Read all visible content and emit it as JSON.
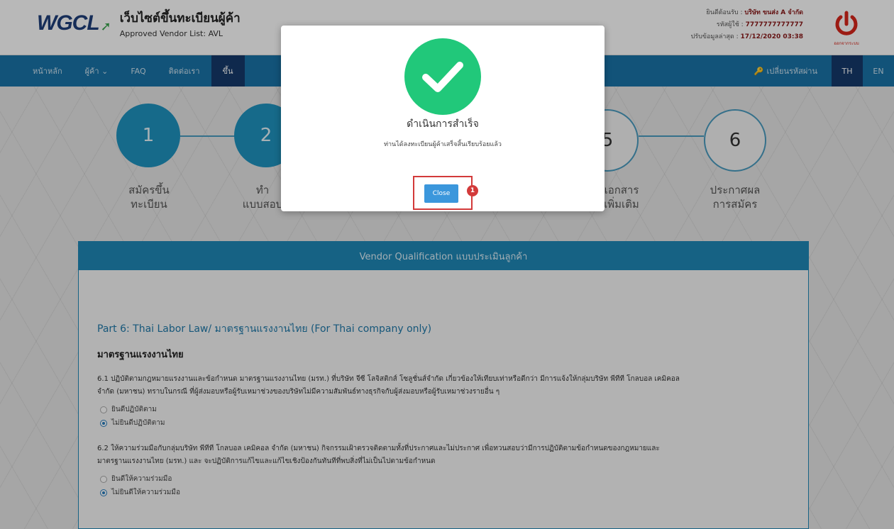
{
  "header": {
    "logo": "WGCL",
    "site_title": "เว็บไซต์ขึ้นทะเบียนผู้ค้า",
    "site_subtitle": "Approved Vendor List: AVL",
    "welcome_label": "ยินดีต้อนรับ :",
    "welcome_name": "บริษัท ขนส่ง A จำกัด",
    "code_label": "รหัสผู้ใช้ :",
    "code_value": "7777777777777",
    "updated_label": "ปรับข้อมูลล่าสุด :",
    "updated_value": "17/12/2020 03:38",
    "logout_label": "ออกจากระบบ"
  },
  "nav": {
    "items": [
      "หน้าหลัก",
      "ผู้ค้า ⌄",
      "FAQ",
      "ติดต่อเรา",
      "ขึ้น"
    ],
    "change_password": "เปลี่ยนรหัสผ่าน",
    "lang_th": "TH",
    "lang_en": "EN"
  },
  "steps": [
    {
      "number": "1",
      "label_line1": "สมัครขึ้น",
      "label_line2": "ทะเบียน"
    },
    {
      "number": "2",
      "label_line1": "ทำ",
      "label_line2": "แบบสอบ"
    },
    {
      "number": "5",
      "label_line1": "เอกสาร",
      "label_line2": "เพิ่มเติม"
    },
    {
      "number": "6",
      "label_line1": "ประกาศผล",
      "label_line2": "การสมัคร"
    }
  ],
  "card": {
    "header": "Vendor Qualification แบบประเมินลูกค้า",
    "part_title": "Part 6: Thai Labor Law/ มาตรฐานแรงงานไทย (For Thai company only)",
    "section_title": "มาตรฐานแรงงานไทย",
    "q1_line1": "6.1 ปฏิบัติตามกฎหมายแรงงานและข้อกำหนด มาตรฐานแรงงานไทย (มรท.) ที่บริษัท จีซี โลจิสติกส์ โซลูชั่นส์จำกัด เกี่ยวข้องให้เทียบเท่าหรือดีกว่า มีการแจ้งให้กลุ่มบริษัท พีทีที โกลบอล เคมิคอล",
    "q1_line2": "จำกัด (มหาชน) ทราบในกรณี ที่ผู้ส่งมอบหรือผู้รับเหมาช่วงของบริษัทไม่มีความสัมพันธ์ทางธุรกิจกับผู้ส่งมอบหรือผู้รับเหมาช่วงรายอื่น ๆ",
    "q1_opt1": "ยินดีปฏิบัติตาม",
    "q1_opt2": "ไม่ยินดีปฏิบัติตาม",
    "q2_line1": "6.2 ให้ความร่วมมือกับกลุ่มบริษัท พีทีที โกลบอล เคมิคอล จำกัด (มหาชน) กิจกรรมเฝ้าตรวจติดตามทั้งที่ประกาศและไม่ประกาศ เพื่อทวนสอบว่ามีการปฏิบัติตามข้อกำหนดของกฎหมายและ",
    "q2_line2": "มาตรฐานแรงงานไทย (มรท.) และ จะปฏิบัติการแก้ไขและแก้ไขเชิงป้องกันทันทีที่พบสิ่งที่ไม่เป็นไปตามข้อกำหนด",
    "q2_opt1": "ยินดีให้ความร่วมมือ",
    "q2_opt2": "ไม่ยินดีให้ความร่วมมือ"
  },
  "modal": {
    "title": "ดำเนินการสำเร็จ",
    "message": "ท่านได้ลงทะเบียนผู้ค้าเสร็จสิ้นเรียบร้อยแล้ว",
    "close_label": "Close",
    "badge": "1"
  },
  "colors": {
    "nav": "#1a74a8",
    "nav_active": "#163a6b",
    "success": "#21c87a",
    "button": "#3b97dc",
    "highlight": "#d33a3a"
  }
}
